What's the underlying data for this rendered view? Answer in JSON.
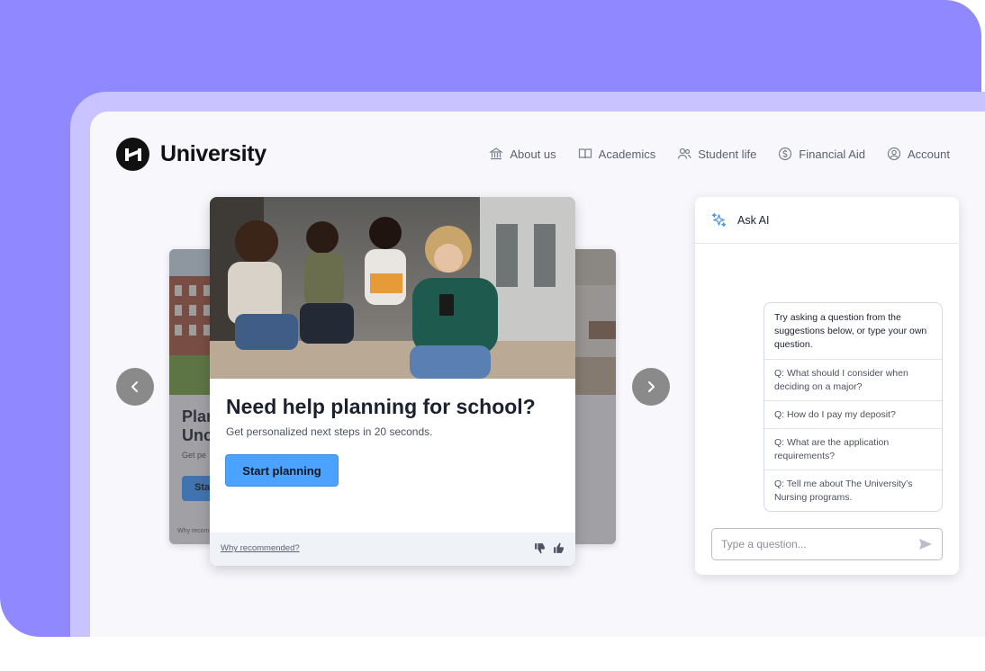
{
  "brand": {
    "name": "University"
  },
  "nav": [
    {
      "label": "About us",
      "icon": "bank-icon"
    },
    {
      "label": "Academics",
      "icon": "book-icon"
    },
    {
      "label": "Student life",
      "icon": "users-icon"
    },
    {
      "label": "Financial Aid",
      "icon": "dollar-icon"
    },
    {
      "label": "Account",
      "icon": "user-icon"
    }
  ],
  "carousel": {
    "main": {
      "title": "Need help planning for school?",
      "subtitle": "Get personalized next steps in 20 seconds.",
      "button": "Start planning",
      "why": "Why recommended?"
    },
    "left": {
      "title": "Plan\nUnc",
      "subtitle": "Get pe",
      "button": "Sta",
      "why": "Why recom"
    }
  },
  "ai": {
    "title": "Ask AI",
    "intro": "Try asking a question from the suggestions below, or type your own question.",
    "suggestions": [
      "Q: What should I consider when deciding on a major?",
      "Q: How do I pay my deposit?",
      "Q: What are the application requirements?",
      "Q: Tell me about The University’s Nursing programs."
    ],
    "placeholder": "Type a question..."
  },
  "colors": {
    "backdrop": "#9088ff",
    "frame": "#c9c4ff",
    "accent": "#4ba3ff",
    "ai_sparkle": "#3c97ff"
  }
}
